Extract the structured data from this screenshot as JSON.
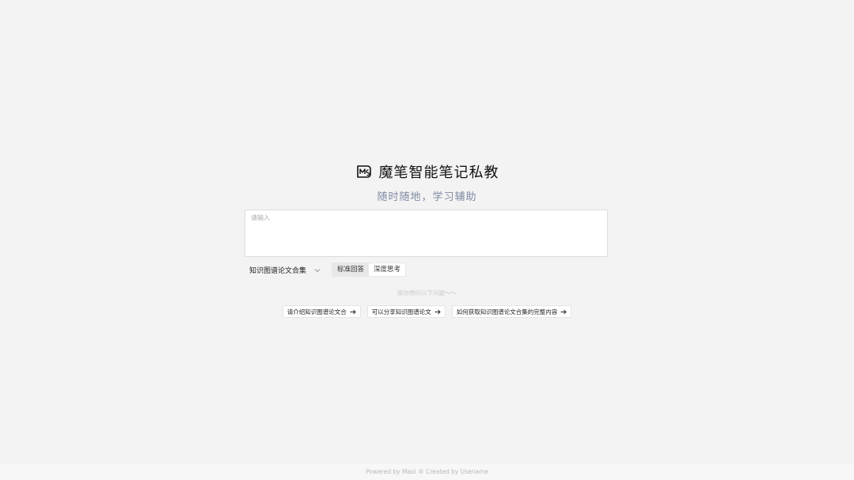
{
  "header": {
    "logo_icon": "ms-logo-icon",
    "title": "魔笔智能笔记私教",
    "subtitle": "随时随地，学习辅助"
  },
  "input": {
    "placeholder": "请输入",
    "value": ""
  },
  "controls": {
    "knowledge_base": "知识图谱论文合集",
    "knowledge_base_icon": "chevron-down-icon",
    "modes": [
      {
        "label": "标准回答",
        "active": false
      },
      {
        "label": "深度思考",
        "active": true
      }
    ]
  },
  "hint": "猜你想问以下问题～～",
  "suggestions": [
    {
      "label": "请介绍知识图谱论文合",
      "icon": "arrow-right-icon"
    },
    {
      "label": "可以分享知识图谱论文",
      "icon": "arrow-right-icon"
    },
    {
      "label": "如何获取知识图谱论文合集的完整内容",
      "icon": "arrow-right-icon"
    }
  ],
  "footer": "Powered by Maoi ® Created by Usename",
  "colors": {
    "background": "#f3f3f3",
    "subtitle": "#7f8aa3",
    "hint": "#cbcbcb",
    "footer_text": "#b9b9b9"
  }
}
